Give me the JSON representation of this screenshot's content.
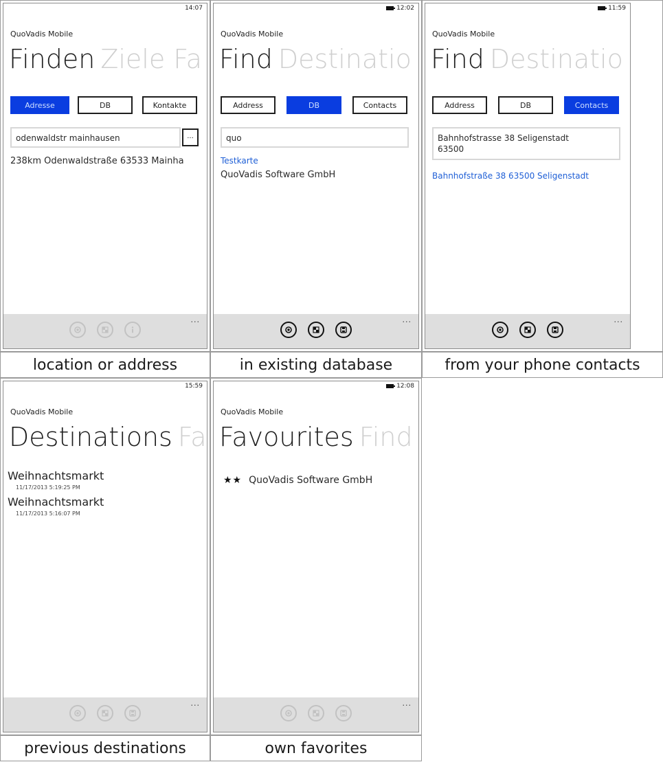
{
  "app_title": "QuoVadis Mobile",
  "captions": {
    "p1": "location or address",
    "p2": "in existing database",
    "p3": "from your phone contacts",
    "p4": "previous destinations",
    "p5": "own favorites"
  },
  "p1": {
    "time": "14:07",
    "pivot_active": "Finden",
    "pivot_next": "Ziele Fa",
    "tabs": [
      "Adresse",
      "DB",
      "Kontakte"
    ],
    "input_value": "odenwaldstr mainhausen",
    "more_label": "...",
    "result": "238km Odenwaldstraße 63533 Mainha"
  },
  "p2": {
    "time": "12:02",
    "pivot_active": "Find",
    "pivot_next": "Destinatio",
    "tabs": [
      "Address",
      "DB",
      "Contacts"
    ],
    "input_value": "quo",
    "results": [
      "Testkarte",
      "QuoVadis Software GmbH"
    ]
  },
  "p3": {
    "time": "11:59",
    "pivot_active": "Find",
    "pivot_next": "Destinatio",
    "tabs": [
      "Address",
      "DB",
      "Contacts"
    ],
    "input_line1": "Bahnhofstrasse 38 Seligenstadt",
    "input_line2": "63500",
    "result": "Bahnhofstraße 38 63500 Seligenstadt"
  },
  "p4": {
    "time": "15:59",
    "pivot_active": "Destinations",
    "pivot_next": "Fa",
    "items": [
      {
        "title": "Weihnachtsmarkt",
        "date": "11/17/2013 5:19:25 PM"
      },
      {
        "title": "Weihnachtsmarkt",
        "date": "11/17/2013 5:16:07 PM"
      }
    ]
  },
  "p5": {
    "time": "12:08",
    "pivot_active": "Favourites",
    "pivot_next": "Find",
    "stars": "★★",
    "fav_name": "QuoVadis Software GmbH"
  },
  "appbar": {
    "dots": "...",
    "icons": [
      "location-icon",
      "checkered-flag-icon",
      "save-icon"
    ]
  },
  "colors": {
    "accent": "#0a3de0",
    "link": "#1f5fd6",
    "appbar": "#dedede"
  }
}
